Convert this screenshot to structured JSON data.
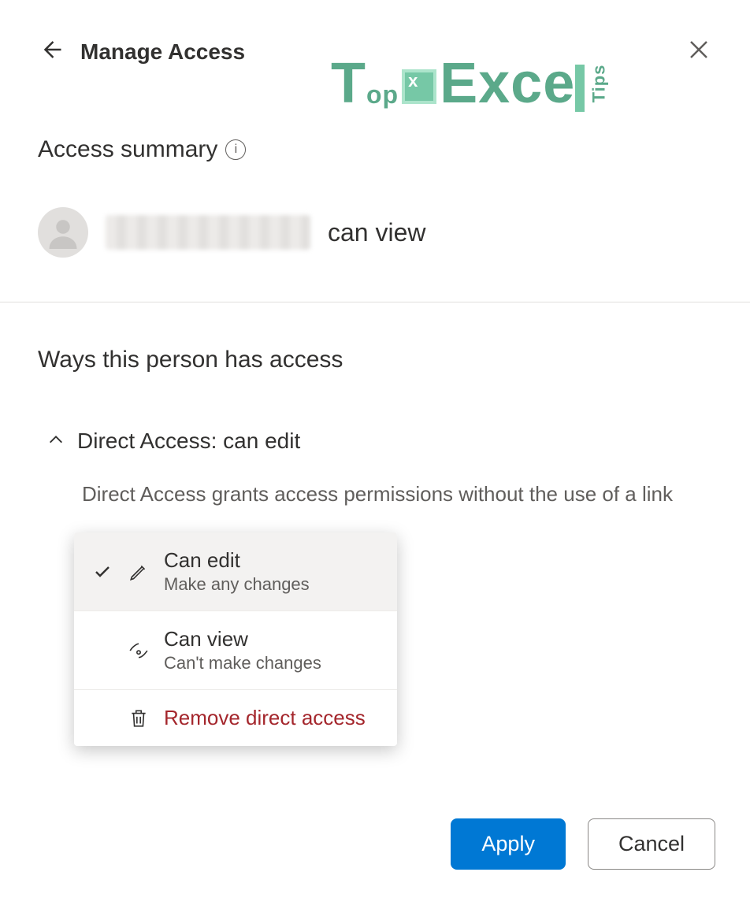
{
  "header": {
    "title": "Manage Access"
  },
  "watermark": {
    "brand_top": "T",
    "brand_op": "op",
    "brand_excel": "Exce",
    "brand_tips": "Tips"
  },
  "summary": {
    "title": "Access summary",
    "info_glyph": "i",
    "user_permission": "can view"
  },
  "ways": {
    "title": "Ways this person has access"
  },
  "direct_access": {
    "header": "Direct Access: can edit",
    "description": "Direct Access grants access permissions without the use of a link",
    "dropdown_label": "Can edit",
    "options": [
      {
        "title": "Can edit",
        "subtitle": "Make any changes",
        "selected": true,
        "icon": "pencil"
      },
      {
        "title": "Can view",
        "subtitle": "Can't make changes",
        "selected": false,
        "icon": "eye"
      }
    ],
    "remove_label": "Remove direct access"
  },
  "footer": {
    "apply": "Apply",
    "cancel": "Cancel"
  }
}
